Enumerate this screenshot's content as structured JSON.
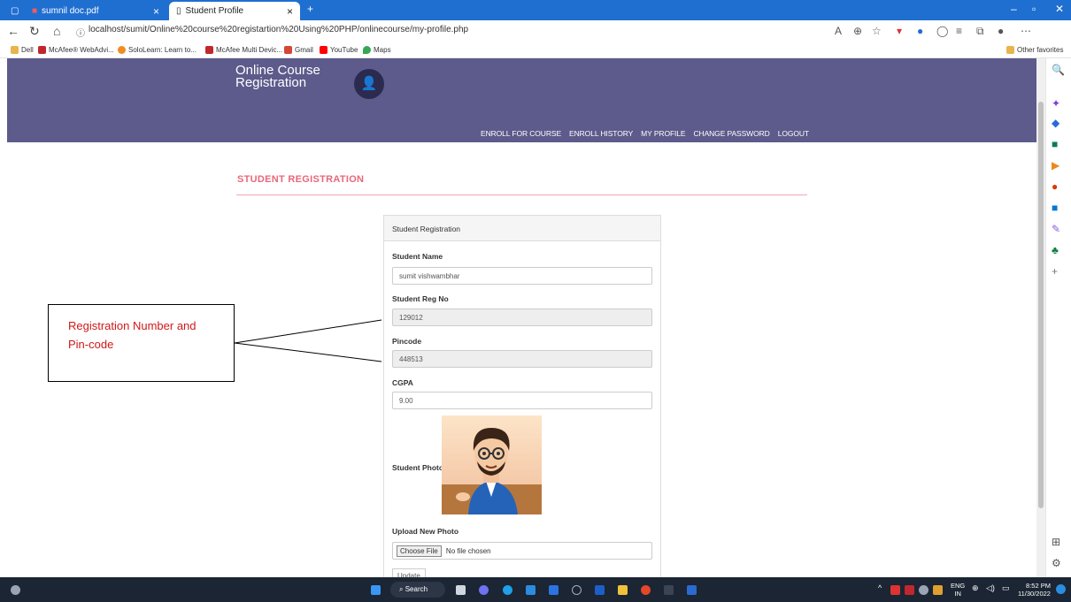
{
  "browser": {
    "tabs": [
      {
        "label": "sumnil doc.pdf"
      },
      {
        "label": "Student Profile"
      }
    ],
    "url": "localhost/sumit/Online%20course%20registartion%20Using%20PHP/onlinecourse/my-profile.php",
    "favorites": [
      "Dell",
      "McAfee® WebAdvi...",
      "SoloLearn: Learn to...",
      "McAfee Multi Devic...",
      "Gmail",
      "YouTube",
      "Maps"
    ],
    "other_favorites": "Other favorites"
  },
  "site": {
    "brand_line1": "Online Course",
    "brand_line2": "Registration",
    "nav": [
      "ENROLL FOR COURSE",
      "ENROLL HISTORY",
      "MY PROFILE",
      "CHANGE PASSWORD",
      "LOGOUT"
    ]
  },
  "page": {
    "heading": "STUDENT REGISTRATION",
    "panel_title": "Student Registration",
    "fields": {
      "name_label": "Student Name",
      "name_value": "sumit vishwambhar",
      "reg_label": "Student Reg No",
      "reg_value": "129012",
      "pincode_label": "Pincode",
      "pincode_value": "448513",
      "cgpa_label": "CGPA",
      "cgpa_value": "9.00",
      "photo_label": "Student Photo",
      "upload_label": "Upload New Photo",
      "choose_file": "Choose File",
      "no_file": "No file chosen",
      "update": "Update"
    }
  },
  "annotation": {
    "line1": "Registration Number and",
    "line2": "Pin-code"
  },
  "taskbar": {
    "search": "Search",
    "lang1": "ENG",
    "lang2": "IN",
    "time": "8:52 PM",
    "date": "11/30/2022"
  }
}
